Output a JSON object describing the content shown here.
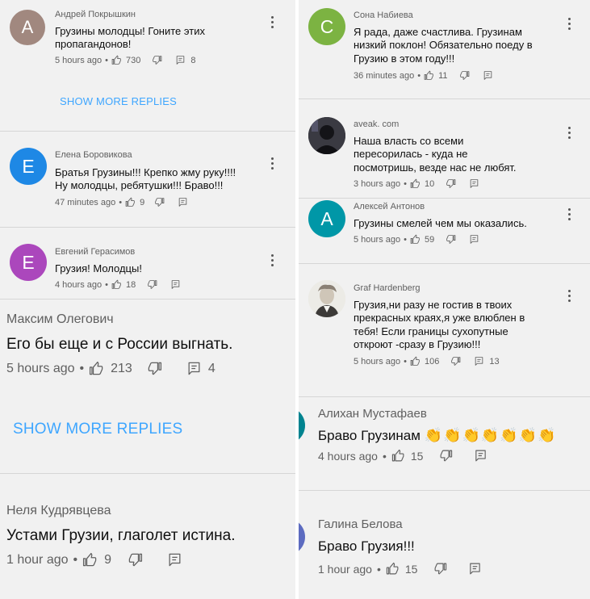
{
  "left": {
    "c1": {
      "avatar_letter": "А",
      "avatar_color": "#a1887f",
      "author": "Андрей Покрышкин",
      "text": "Грузины молодцы! Гоните этих\nпропагандонов!",
      "time": "5 hours ago",
      "likes": "730",
      "replies": "8"
    },
    "show_more_1": "SHOW MORE REPLIES",
    "c2": {
      "avatar_letter": "Е",
      "avatar_color": "#1e88e5",
      "author": "Елена Боровикова",
      "text": "Братья Грузины!!! Крепко жму руку!!!!\nНу молодцы, ребятушки!!! Браво!!!",
      "time": "47 minutes ago",
      "likes": "9"
    },
    "c3": {
      "avatar_letter": "Е",
      "avatar_color": "#ab47bc",
      "author": "Евгений Герасимов",
      "text": "Грузия! Молодцы!",
      "time": "4 hours ago",
      "likes": "18"
    },
    "c4": {
      "author": "Максим Олегович",
      "text": "Его бы еще и с России выгнать.",
      "time": "5 hours ago",
      "likes": "213",
      "replies": "4"
    },
    "show_more_2": "SHOW MORE REPLIES",
    "c5": {
      "author": "Неля Кудрявцева",
      "text": "Устами Грузии, глаголет истина.",
      "time": "1 hour ago",
      "likes": "9"
    }
  },
  "right": {
    "c1": {
      "avatar_letter": "С",
      "avatar_color": "#7cb342",
      "author": "Сона Набиева",
      "text": "Я рада, даже счастлива. Грузинам\nнизкий поклон! Обязательно поеду в\nГрузию в этом году!!!",
      "time": "36 minutes ago",
      "likes": "11"
    },
    "c2": {
      "author": "aveak. com",
      "text": "Наша власть со всеми\nпересорилась - куда не\nпосмотришь, везде нас не любят.",
      "time": "3 hours ago",
      "likes": "10"
    },
    "c3": {
      "avatar_letter": "А",
      "avatar_color": "#0097a7",
      "author": "Алексей Антонов",
      "text": "Грузины смелей чем мы оказались.",
      "time": "5 hours ago",
      "likes": "59"
    },
    "c4": {
      "author": "Graf Hardenberg",
      "text": "Грузия,ни разу не гостив в твоих\nпрекрасных краях,я уже влюблен в\nтебя! Если границы сухопутные\nоткроют -сразу в Грузию!!!",
      "time": "5 hours ago",
      "likes": "106",
      "replies": "13"
    },
    "c5": {
      "author": "Алихан Мустафаев",
      "text": "Браво Грузинам",
      "time": "4 hours ago",
      "likes": "15",
      "avatar_color": "#00838f"
    },
    "c6": {
      "author": "Галина Белова",
      "text": "Браво Грузия!!!",
      "time": "1 hour ago",
      "likes": "15",
      "avatar_color": "#5c6bc0"
    }
  },
  "icons": {
    "like": "thumb-up-icon",
    "dislike": "thumb-down-icon",
    "reply": "reply-icon",
    "more": "more-vert-icon",
    "clap": "clapping-hands-emoji"
  },
  "meta_separator": "•"
}
